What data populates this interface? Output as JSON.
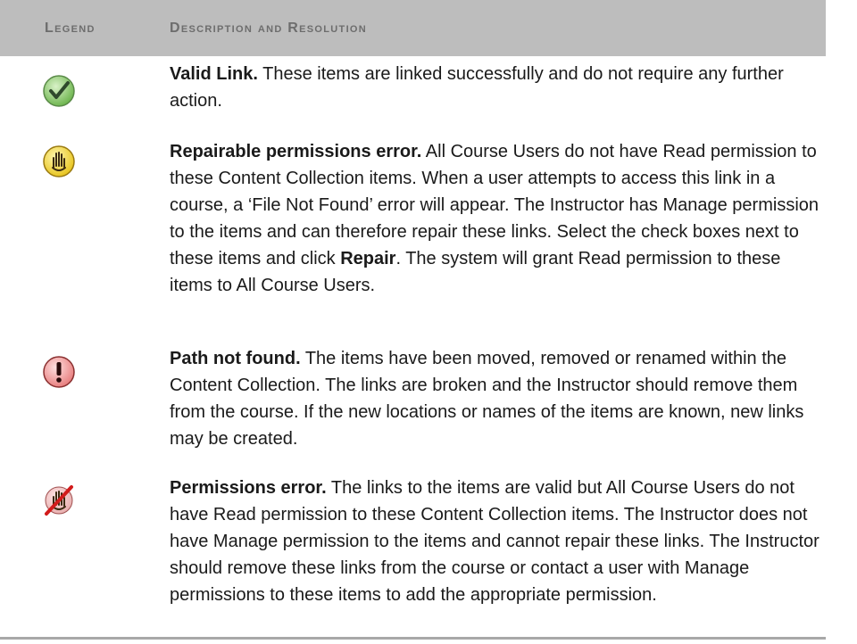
{
  "header": {
    "legend_label": "Legend",
    "description_label": "Description and Resolution"
  },
  "rows": [
    {
      "icon": "valid-link-check-icon",
      "title": "Valid Link.",
      "text": " These items are linked successfully and do not require any further action."
    },
    {
      "icon": "repairable-hand-icon",
      "title": "Repairable permissions error.",
      "text_before": " All Course Users do not have Read permission to these Content Collection items. When a user attempts to access this link in a course, a ‘File Not Found’ error will appear. The Instructor has Manage permission to the items and can therefore repair these links. Select the check boxes next to these items and click ",
      "bold_word": "Repair",
      "text_after": ". The system will grant Read permission to these items to All Course Users."
    },
    {
      "icon": "exclamation-icon",
      "title": "Path not found.",
      "text": " The items have been moved, removed or renamed within the Content Collection. The links are broken and the Instructor should remove them from the course. If the new locations or names of the items are known, new links may be created."
    },
    {
      "icon": "no-permission-hand-icon",
      "title": "Permissions error.",
      "text": " The links to the items are valid but All Course Users do not have Read permission to these Content Collection items. The Instructor does not have Manage permission to the items and cannot repair these links. The Instructor should remove these links from the course or contact a user with Manage permissions to these items to add the appropriate permission."
    }
  ]
}
